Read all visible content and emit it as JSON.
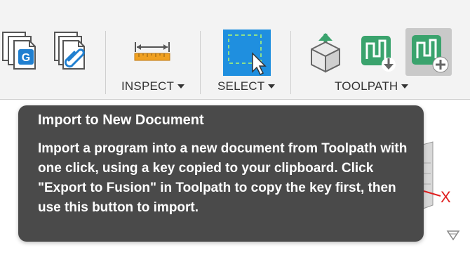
{
  "toolbar": {
    "groups": [
      {
        "label": "INSPECT"
      },
      {
        "label": "SELECT"
      },
      {
        "label": "TOOLPATH"
      }
    ],
    "g_badge": "G"
  },
  "tooltip": {
    "title": "Import to New Document",
    "body": "Import a program into a new document from Toolpath with one click, using a key copied to your clipboard. Click \"Export to Fusion\" in Toolpath to copy the key first, then use this button to import."
  },
  "viewport": {
    "axis_label": "X"
  },
  "colors": {
    "select_blue": "#1f8fdf",
    "toolpath_green": "#3aa36d",
    "ruler_orange": "#f0a020",
    "axis_red": "#e02020",
    "tooltip_bg": "#4a4a4a"
  }
}
